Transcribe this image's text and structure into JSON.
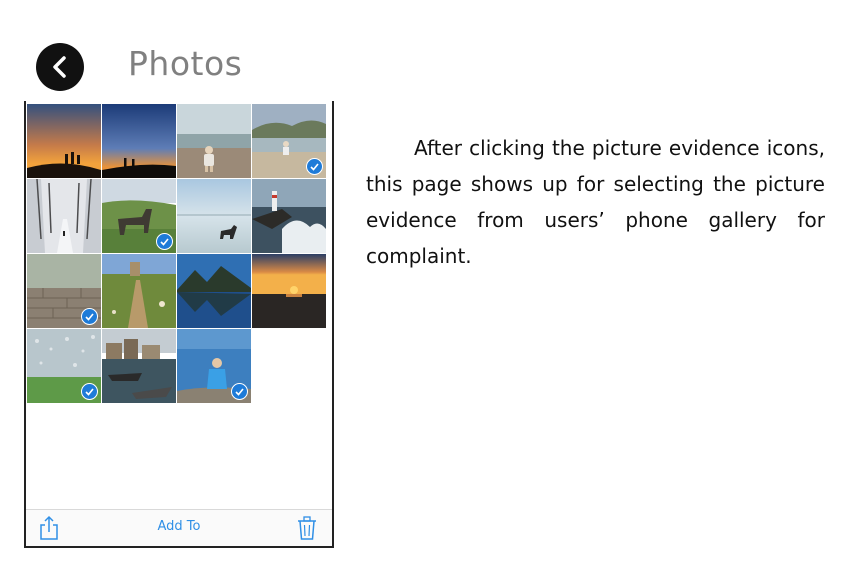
{
  "header": {
    "title": "Photos",
    "back_icon": "chevron-left-icon"
  },
  "gallery": {
    "photos": [
      {
        "name": "sunset-silhouettes",
        "selected": false
      },
      {
        "name": "dusk-silhouettes",
        "selected": false
      },
      {
        "name": "child-on-beach",
        "selected": false
      },
      {
        "name": "beach-scene",
        "selected": true
      },
      {
        "name": "snowy-trees",
        "selected": false
      },
      {
        "name": "horse-in-field",
        "selected": true
      },
      {
        "name": "dog-on-shore",
        "selected": false
      },
      {
        "name": "lighthouse-waves",
        "selected": false
      },
      {
        "name": "stone-wall",
        "selected": true
      },
      {
        "name": "country-path",
        "selected": false
      },
      {
        "name": "mountain-lake",
        "selected": false
      },
      {
        "name": "ocean-sunset",
        "selected": false
      },
      {
        "name": "rain-window",
        "selected": true
      },
      {
        "name": "harbor-boats",
        "selected": false
      },
      {
        "name": "child-by-sea",
        "selected": true
      }
    ]
  },
  "toolbar": {
    "share_icon": "share-icon",
    "add_label": "Add To",
    "trash_icon": "trash-icon"
  },
  "caption": "After clicking the picture evidence icons, this page shows up for selecting the picture evidence from users’ phone gallery for complaint.",
  "colors": {
    "accent": "#2f8fe6",
    "check": "#1e7bd8",
    "title": "#808080"
  }
}
